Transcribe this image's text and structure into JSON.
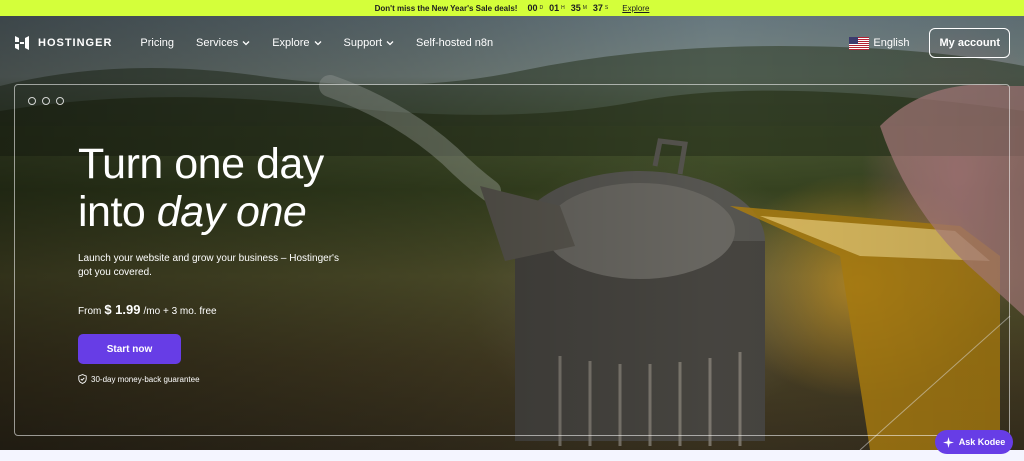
{
  "promo": {
    "message": "Don't miss the New Year's Sale deals!",
    "timer": [
      {
        "value": "00",
        "unit": "D"
      },
      {
        "value": "01",
        "unit": "H"
      },
      {
        "value": "35",
        "unit": "M"
      },
      {
        "value": "37",
        "unit": "S"
      }
    ],
    "link": "Explore",
    "bg_color": "#d4ff3a"
  },
  "nav": {
    "brand": "HOSTINGER",
    "links": [
      {
        "label": "Pricing",
        "icon": ""
      },
      {
        "label": "Services",
        "icon": "chevron-down-icon"
      },
      {
        "label": "Explore",
        "icon": "chevron-down-icon"
      },
      {
        "label": "Support",
        "icon": "chevron-down-icon"
      },
      {
        "label": "Self-hosted n8n",
        "icon": ""
      }
    ],
    "language": "English",
    "language_icon": "us-flag-icon",
    "account_button": "My account"
  },
  "hero": {
    "headline_line1": "Turn one day",
    "headline_line2_plain": "into ",
    "headline_line2_italic": "day one",
    "subtitle": "Launch your website and grow your business – Hostinger's got you covered.",
    "price_prefix": "From",
    "price": "$ 1.99",
    "price_suffix": "/mo + 3 mo. free",
    "cta": "Start now",
    "guarantee": "30-day money-back guarantee",
    "accent_color": "#673de6"
  },
  "assistant": {
    "label": "Ask Kodee",
    "icon": "sparkle-icon"
  }
}
